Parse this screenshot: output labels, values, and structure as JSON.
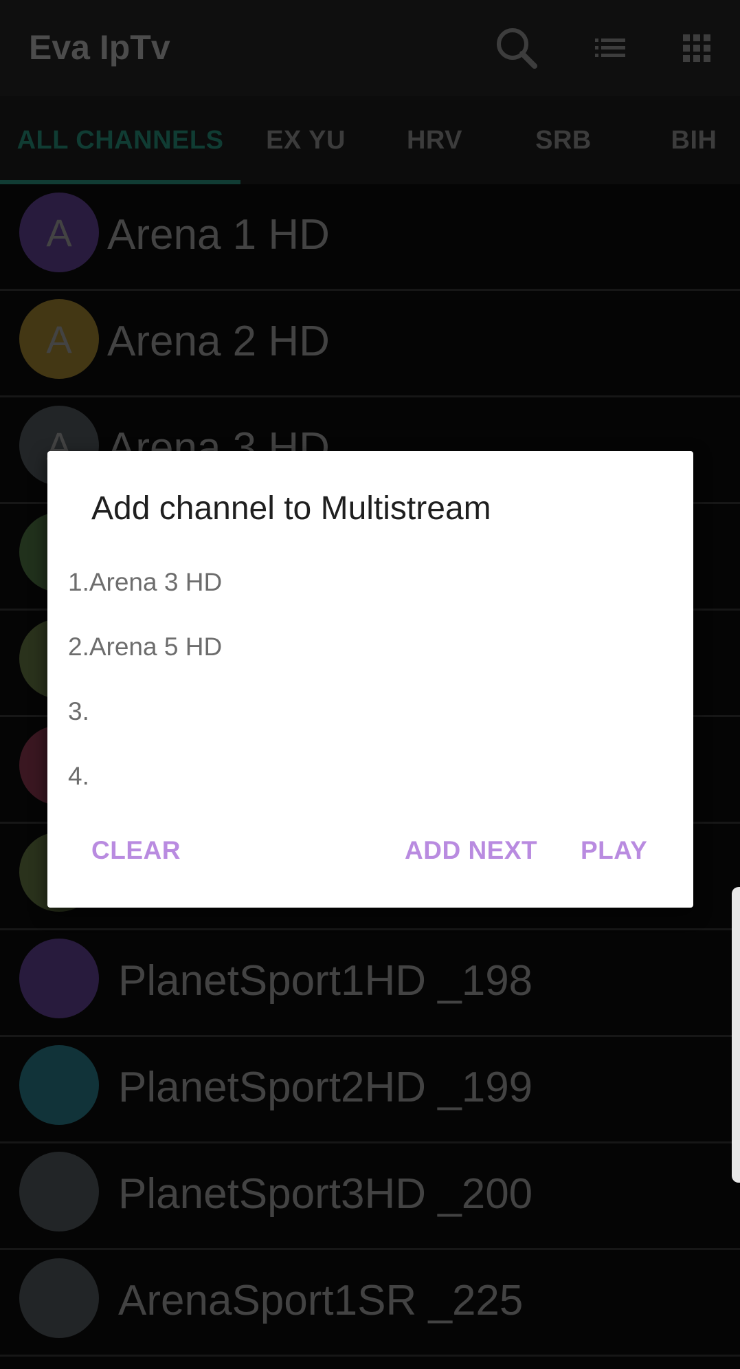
{
  "app": {
    "title": "Eva IpTv",
    "icons": [
      "search-icon",
      "list-icon",
      "grid-icon"
    ]
  },
  "tabs": [
    {
      "label": "ALL CHANNELS",
      "active": true
    },
    {
      "label": "EX YU",
      "active": false
    },
    {
      "label": "HRV",
      "active": false
    },
    {
      "label": "SRB",
      "active": false
    },
    {
      "label": "BIH",
      "active": false
    }
  ],
  "channels": [
    {
      "letter": "A",
      "name": "Arena 1 HD",
      "color": "#4a3270"
    },
    {
      "letter": "A",
      "name": "Arena 2 HD",
      "color": "#7a6426"
    },
    {
      "letter": "A",
      "name": "Arena 3 HD",
      "color": "#3f4448"
    },
    {
      "letter": "",
      "name": "",
      "color": "#3c5a34"
    },
    {
      "letter": "",
      "name": "",
      "color": "#4e5b34"
    },
    {
      "letter": "",
      "name": "",
      "color": "#6a2a3c"
    },
    {
      "letter": "",
      "name": "",
      "color": "#4e5b34"
    },
    {
      "letter": "",
      "name": "PlanetSport1HD _198",
      "color": "#4a3270"
    },
    {
      "letter": "",
      "name": "PlanetSport2HD _199",
      "color": "#1f5e68"
    },
    {
      "letter": "",
      "name": "PlanetSport3HD _200",
      "color": "#3f4448"
    },
    {
      "letter": "",
      "name": "ArenaSport1SR _225",
      "color": "#3f4448"
    }
  ],
  "dialog": {
    "title": "Add channel to Multistream",
    "items": [
      "1.Arena 3 HD",
      "2.Arena 5 HD",
      "3.",
      "4."
    ],
    "buttons": {
      "clear": "CLEAR",
      "add_next": "ADD NEXT",
      "play": "PLAY"
    }
  },
  "colors": {
    "accent": "#1f6e60",
    "dialog_button": "#b98be0"
  }
}
